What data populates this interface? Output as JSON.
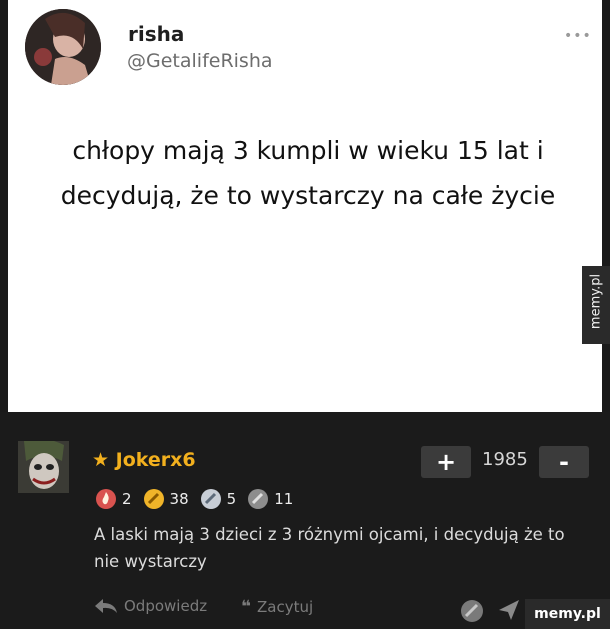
{
  "tweet": {
    "username": "risha",
    "handle": "@GetalifeRisha",
    "text": "chłopy mają 3 kumpli w wieku 15 lat i decydują, że to wystarczy na całe życie"
  },
  "watermark": "memy.pl",
  "comment": {
    "author": "Jokerx6",
    "score": "1985",
    "plus_label": "+",
    "minus_label": "-",
    "badges": [
      {
        "icon": "fire-badge-icon",
        "count": "2"
      },
      {
        "icon": "gold-badge-icon",
        "count": "38"
      },
      {
        "icon": "silver-badge-icon",
        "count": "5"
      },
      {
        "icon": "grey-badge-icon",
        "count": "11"
      }
    ],
    "text": "A laski mają 3 dzieci z 3 różnymi ojcami, i decydują że to nie wystarczy",
    "reply_label": "Odpowiedz",
    "quote_label": "Zacytuj"
  },
  "site_logo": "memy.pl",
  "colors": {
    "author": "#f2b01e",
    "background": "#1b1b1b",
    "card": "#ffffff"
  }
}
